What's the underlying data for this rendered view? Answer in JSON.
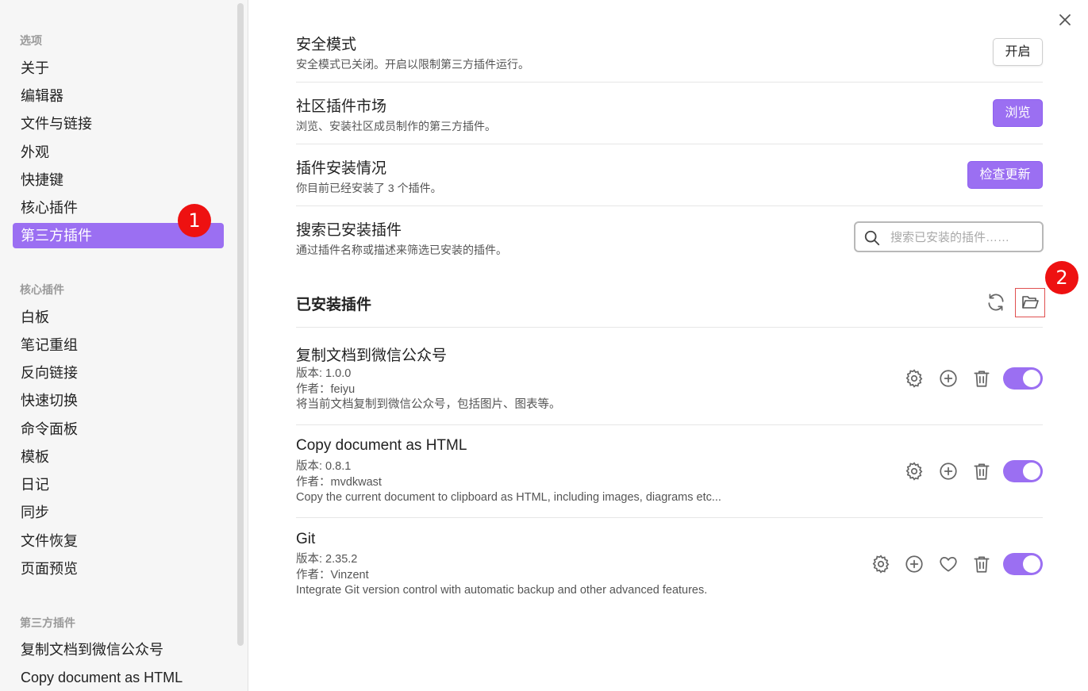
{
  "sidebar": {
    "groups": [
      {
        "title": "选项",
        "items": [
          "关于",
          "编辑器",
          "文件与链接",
          "外观",
          "快捷键",
          "核心插件",
          "第三方插件"
        ]
      },
      {
        "title": "核心插件",
        "items": [
          "白板",
          "笔记重组",
          "反向链接",
          "快速切换",
          "命令面板",
          "模板",
          "日记",
          "同步",
          "文件恢复",
          "页面预览"
        ]
      },
      {
        "title": "第三方插件",
        "items": [
          "复制文档到微信公众号",
          "Copy document as HTML"
        ]
      }
    ],
    "active_item": "第三方插件"
  },
  "markers": {
    "first": "1",
    "second": "2"
  },
  "settings": {
    "safe_mode": {
      "title": "安全模式",
      "desc": "安全模式已关闭。开启以限制第三方插件运行。",
      "button": "开启"
    },
    "community": {
      "title": "社区插件市场",
      "desc": "浏览、安装社区成员制作的第三方插件。",
      "button": "浏览"
    },
    "install_status": {
      "title": "插件安装情况",
      "desc": "你目前已经安装了 3 个插件。",
      "button": "检查更新"
    },
    "search": {
      "title": "搜索已安装插件",
      "desc": "通过插件名称或描述来筛选已安装的插件。",
      "placeholder": "搜索已安装的插件……"
    }
  },
  "installed": {
    "title": "已安装插件",
    "plugins": [
      {
        "name": "复制文档到微信公众号",
        "version": "版本: 1.0.0",
        "author": "作者：feiyu",
        "desc": "将当前文档复制到微信公众号，包括图片、图表等。",
        "enabled": true
      },
      {
        "name": "Copy document as HTML",
        "version": "版本: 0.8.1",
        "author": "作者：mvdkwast",
        "desc": "Copy the current document to clipboard as HTML, including images, diagrams etc...",
        "enabled": true
      },
      {
        "name": "Git",
        "version": "版本: 2.35.2",
        "author": "作者：Vinzent",
        "desc": "Integrate Git version control with automatic backup and other advanced features.",
        "enabled": true
      }
    ]
  },
  "colors": {
    "accent": "#9b6ff2",
    "marker": "#ee1111"
  }
}
